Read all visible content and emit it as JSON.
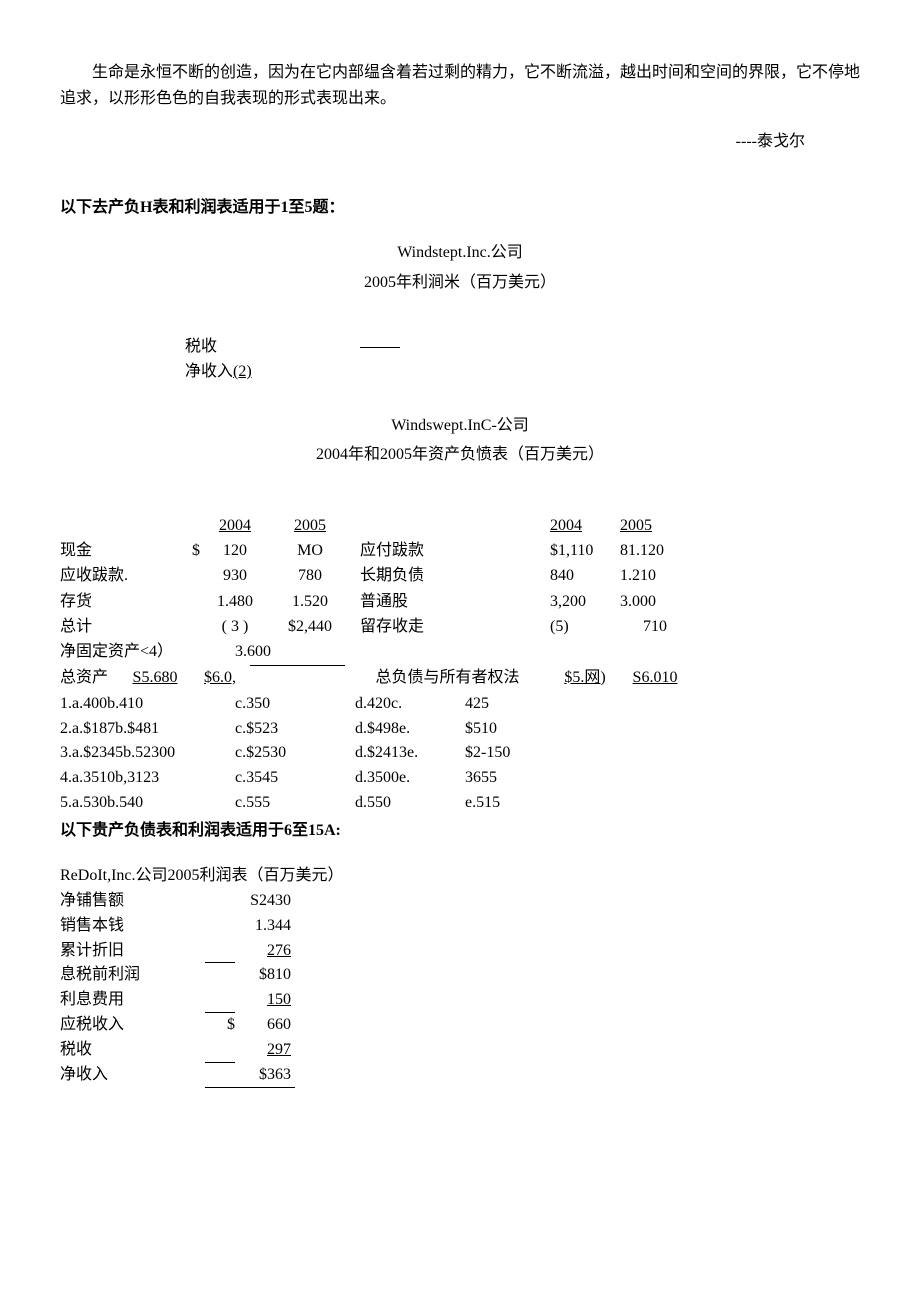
{
  "intro": "生命是永恒不断的创造，因为在它内部缊含着若过剩的精力，它不断流溢，越出时间和空间的界限，它不停地追求，以形形色色的自我表现的形式表现出来。",
  "author": "----泰戈尔",
  "s1_header": "以下去产负H表和利润表适用于1至5题：",
  "windswept_title1": "Windstept.Inc.公司",
  "windswept_sub1": "2005年利涧米（百万美元）",
  "tax_label": "税收",
  "netinc_label": "净收入",
  "netinc_num": "(2)",
  "windswept_title2": "Windswept.InC-公司",
  "windswept_sub2": "2004年和2005年资产负愤表（百万美元）",
  "bal": {
    "hdr_2004": "2004",
    "hdr_2005": "2005",
    "cash": {
      "label": "现金",
      "cur": "$",
      "v2004": "120",
      "v2005": "MO"
    },
    "ar": {
      "label": "应收跋款.",
      "v2004": "930",
      "v2005": "780"
    },
    "inv": {
      "label": "存货",
      "v2004": "1.480",
      "v2005": "1.520"
    },
    "tot": {
      "label": "总计",
      "v2004": "( 3 )",
      "v2005": "$2,440"
    },
    "nfa": {
      "label": "净固定资产<4）",
      "v": "3.600"
    },
    "ta": {
      "label": "总资产",
      "v2004_pre": "S5.680",
      "v2005_pre": "$6.0,"
    },
    "ap": {
      "label": "应付跋款",
      "v2004": "$1,110",
      "v2005": "81.120"
    },
    "ltd": {
      "label": "长期负债",
      "v2004": "840",
      "v2005": "1.210"
    },
    "cs": {
      "label": "普通股",
      "v2004": "3,200",
      "v2005": "3.000"
    },
    "re": {
      "label": "留存收走",
      "v2004": "(5)",
      "v2005": "710"
    },
    "tle": {
      "label": "总负债与所有者权法",
      "v2004": "$5.网)",
      "v2005": "S6.010"
    }
  },
  "answers": [
    {
      "a": "1.a.400b.410",
      "c": "c.350",
      "d": "d.420c.",
      "e": "425"
    },
    {
      "a": "2.a.$187b.$481",
      "c": "c.$523",
      "d": "d.$498e.",
      "e": "$510"
    },
    {
      "a": "3.a.$2345b.52300",
      "c": "c.$2530",
      "d": "d.$2413e.",
      "e": "$2-150"
    },
    {
      "a": "4.a.3510b,3123",
      "c": "c.3545",
      "d": "d.3500e.",
      "e": "3655"
    },
    {
      "a": "5.a.530b.540",
      "c": "c.555",
      "d": "d.550",
      "e": "e.515"
    }
  ],
  "s2_header": "以下贵产负债表和利润表适用于6至15A:",
  "redoit_title": "ReDoIt,Inc.公司2005利润表（百万美元）",
  "income": {
    "sales": {
      "label": "净铺售额",
      "cur": "",
      "val": "S2430"
    },
    "cogs": {
      "label": "销售本钱",
      "cur": "",
      "val": "1.344"
    },
    "dep": {
      "label": "累计折旧",
      "cur": "",
      "val": "276"
    },
    "ebit": {
      "label": "息税前利润",
      "cur": "",
      "val": "$810"
    },
    "int": {
      "label": "利息费用",
      "cur": "",
      "val": "150"
    },
    "ti": {
      "label": "应税收入",
      "cur": "$",
      "val": "660"
    },
    "tax": {
      "label": "税收",
      "cur": "",
      "val": "297"
    },
    "ni": {
      "label": "净收入",
      "cur": "",
      "val": "$363"
    }
  }
}
